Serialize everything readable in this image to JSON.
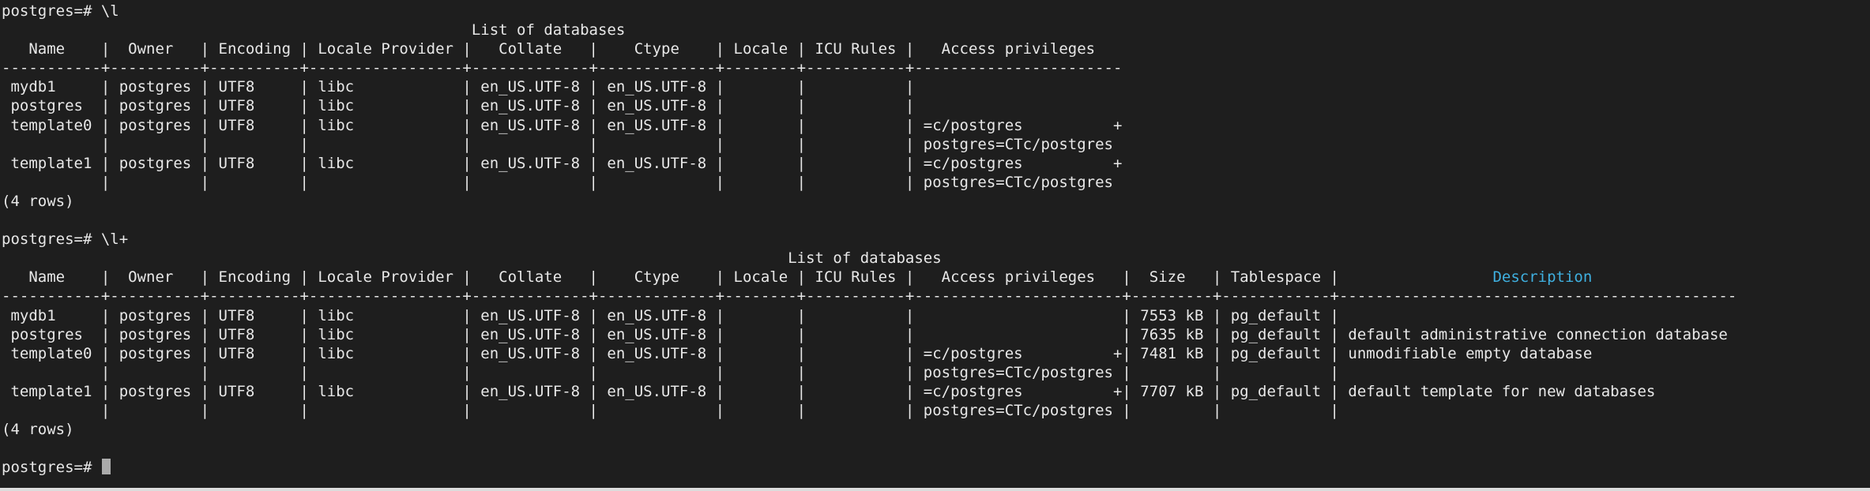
{
  "terminal": {
    "prompt": "postgres=# ",
    "cursor_color": "#aaaaaa",
    "highlight_color": "#3fb0e0",
    "lines": [
      "postgres=# \\l",
      "                                                    List of databases",
      "   Name    |  Owner   | Encoding | Locale Provider |   Collate   |    Ctype    | Locale | ICU Rules |   Access privileges   ",
      "-----------+----------+----------+-----------------+-------------+-------------+--------+-----------+-----------------------",
      " mydb1     | postgres | UTF8     | libc            | en_US.UTF-8 | en_US.UTF-8 |        |           | ",
      " postgres  | postgres | UTF8     | libc            | en_US.UTF-8 | en_US.UTF-8 |        |           | ",
      " template0 | postgres | UTF8     | libc            | en_US.UTF-8 | en_US.UTF-8 |        |           | =c/postgres          +",
      "           |          |          |                 |             |             |        |           | postgres=CTc/postgres",
      " template1 | postgres | UTF8     | libc            | en_US.UTF-8 | en_US.UTF-8 |        |           | =c/postgres          +",
      "           |          |          |                 |             |             |        |           | postgres=CTc/postgres",
      "(4 rows)",
      "",
      "postgres=# \\l+",
      "                                                                                       List of databases",
      "   Name    |  Owner   | Encoding | Locale Provider |   Collate   |    Ctype    | Locale | ICU Rules |   Access privileges   |  Size   | Tablespace |",
      "-----------+----------+----------+-----------------+-------------+-------------+--------+-----------+-----------------------+---------+------------+--------------------------------------------",
      " mydb1     | postgres | UTF8     | libc            | en_US.UTF-8 | en_US.UTF-8 |        |           |                       | 7553 kB | pg_default | ",
      " postgres  | postgres | UTF8     | libc            | en_US.UTF-8 | en_US.UTF-8 |        |           |                       | 7635 kB | pg_default | default administrative connection database",
      " template0 | postgres | UTF8     | libc            | en_US.UTF-8 | en_US.UTF-8 |        |           | =c/postgres          +| 7481 kB | pg_default | unmodifiable empty database",
      "           |          |          |                 |             |             |        |           | postgres=CTc/postgres |         |            | ",
      " template1 | postgres | UTF8     | libc            | en_US.UTF-8 | en_US.UTF-8 |        |           | =c/postgres          +| 7707 kB | pg_default | default template for new databases",
      "           |          |          |                 |             |             |        |           | postgres=CTc/postgres |         |            | ",
      "(4 rows)",
      ""
    ],
    "description_header": "Description",
    "description_header_prefix": "                 ",
    "description_header_suffix": "                 "
  }
}
